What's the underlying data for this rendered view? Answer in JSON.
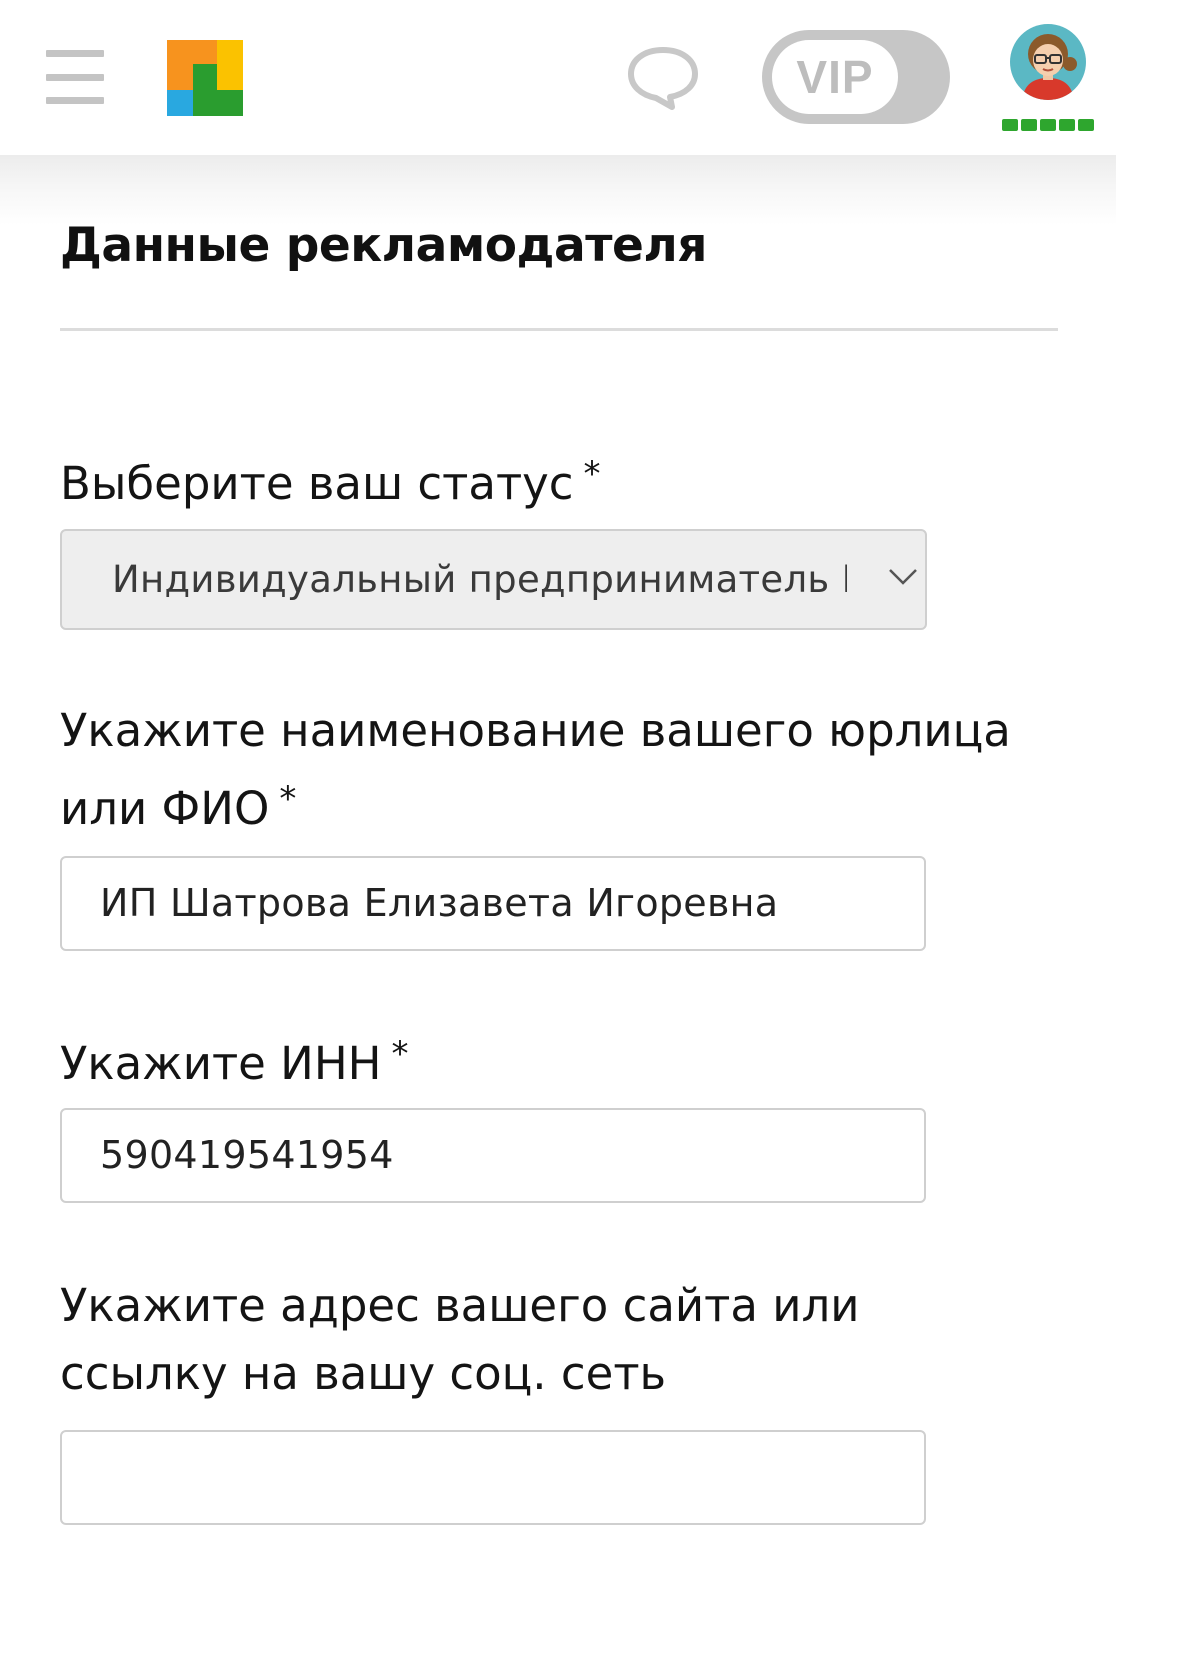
{
  "header": {
    "menu_icon": "hamburger-menu-icon",
    "logo_icon": "colored-blocks-logo",
    "chat_icon": "chat-bubble-icon",
    "vip_label": "VIP",
    "avatar_icon": "user-avatar-girl-glasses",
    "rating_level": "5 of 5",
    "colors": {
      "logo_orange": "#f7931e",
      "logo_yellow": "#fbc200",
      "logo_blue": "#29a8e0",
      "logo_green": "#2a9d2f",
      "rating_green": "#2ea62e",
      "toggle_gray": "#c6c6c6"
    }
  },
  "form": {
    "title": "Данные рекламодателя",
    "status": {
      "label": "Выберите ваш статус",
      "required_mark": "*",
      "selected": "Индивидуальный предприниматель РФ"
    },
    "name": {
      "label": "Укажите наименование вашего юрлица или ФИО",
      "required_mark": "*",
      "value": "ИП Шатрова Елизавета Игоревна"
    },
    "inn": {
      "label": "Укажите ИНН",
      "required_mark": "*",
      "value": "590419541954"
    },
    "website": {
      "label": "Укажите адрес вашего сайта или ссылку на вашу соц. сеть",
      "value": ""
    }
  }
}
